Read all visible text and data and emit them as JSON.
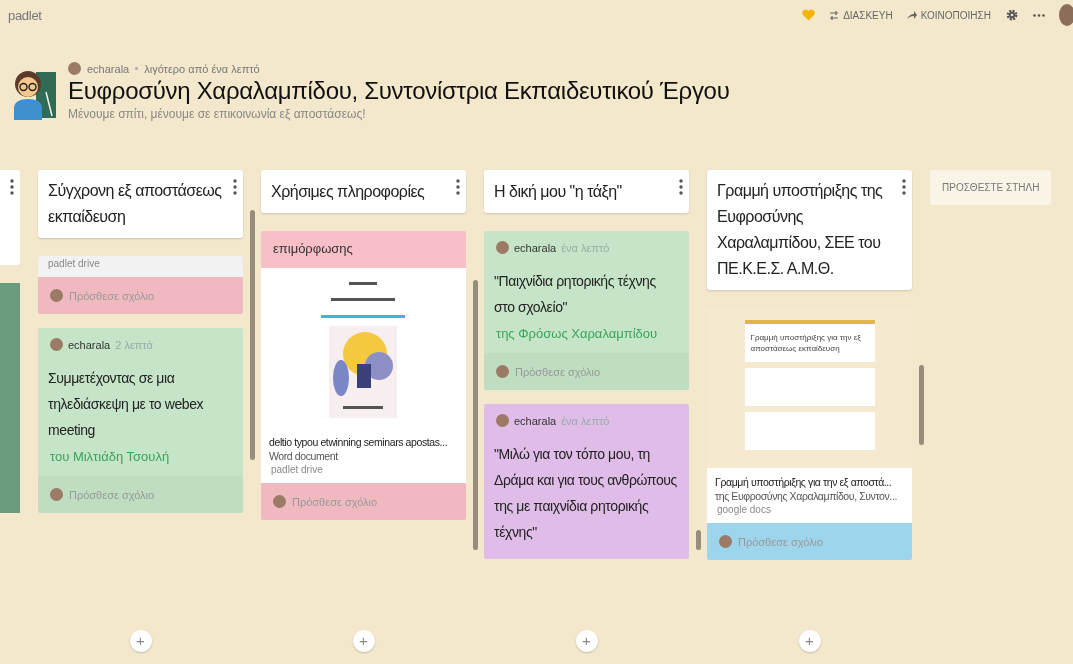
{
  "topbar": {
    "logo": "padlet",
    "actions": [
      {
        "kind": "heart"
      },
      {
        "kind": "remix",
        "label": "ΔΙΑΣΚΕΥΗ"
      },
      {
        "kind": "share",
        "label": "ΚΟΙΝΟΠΟΙΗΣΗ"
      },
      {
        "kind": "settings"
      },
      {
        "kind": "more"
      },
      {
        "kind": "avatar"
      }
    ]
  },
  "header": {
    "author": "echarala",
    "time": "λιγότερο από ένα λεπτό",
    "title": "Ευφροσύνη Χαραλαμπίδου, Συντονίστρια Εκπαιδευτικού Έργου",
    "subtitle": "Μένουμε σπίτι, μένουμε σε επικοινωνία εξ αποστάσεως!"
  },
  "columns": [
    {
      "title": "Σύγχρονη εξ αποστάσεως εκπαίδευση",
      "posts": [
        {
          "color": "#f8bfc6",
          "attachment": {
            "source": "padlet drive"
          },
          "comment_placeholder": "Πρόσθεσε σχόλιο"
        },
        {
          "color": "#c6e5c8",
          "author": "echarala",
          "time": "2 λεπτά",
          "body": "Συμμετέχοντας σε μια τηλεδιάσκεψη με το webex meeting",
          "attribution": "του Μιλτιάδη Τσουλή",
          "comment_placeholder": "Πρόσθεσε σχόλιο"
        }
      ]
    },
    {
      "title": "Χρήσιμες πληροφορίες",
      "posts": [
        {
          "color": "#f8bfc6",
          "excerpt": "επιμόρφωσης",
          "attachment": {
            "kind": "document",
            "title": "deltio typou etwinning seminars apostas...",
            "subtitle": "Word document",
            "source": "padlet drive"
          },
          "comment_placeholder": "Πρόσθεσε σχόλιο"
        }
      ]
    },
    {
      "title": "Η δική μου \"η τάξη\"",
      "posts": [
        {
          "color": "#c6e5c8",
          "author": "echarala",
          "time": "ένα λεπτό",
          "body": "\"Παιχνίδια ρητορικής τέχνης στο σχολείο\"",
          "attribution": "της Φρόσως Χαραλαμπίδου",
          "comment_placeholder": "Πρόσθεσε σχόλιο"
        },
        {
          "color": "#e0bde8",
          "author": "echarala",
          "time": "ένα λεπτό",
          "body": "\"Μιλώ για τον τόπο μου, τη Δράμα και για τους ανθρώπους της με παιχνίδια ρητορικής τέχνης\""
        }
      ]
    },
    {
      "title": "Γραμμή υποστήριξης της Ευφροσύνης Χαραλαμπίδου, ΣΕΕ του ΠΕ.Κ.Ε.Σ. Α.Μ.Θ.",
      "posts": [
        {
          "color": "#a3dcf5",
          "attachment": {
            "kind": "form",
            "preview_title": "Γραμμή υποστήριξης για την εξ αποστάσεως εκπαίδευση",
            "title": "Γραμμή υποστήριξης για την εξ αποστά...",
            "subtitle": "της Ευφροσύνης Χαραλαμπίδου, Συντον...",
            "source": "google docs"
          },
          "comment_placeholder": "Πρόσθεσε σχόλιο"
        }
      ]
    }
  ],
  "add_column": "ΠΡΟΣΘΕΣΤΕ ΣΤΗΛΗ",
  "add_post": "+"
}
